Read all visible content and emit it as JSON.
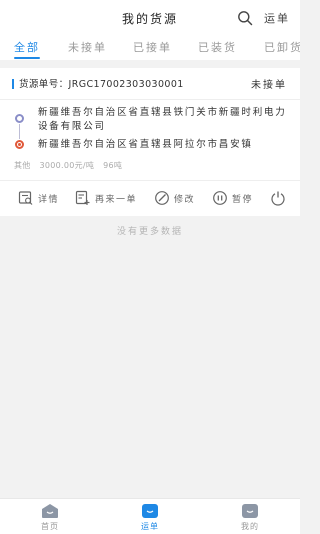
{
  "header": {
    "title": "我的货源",
    "search_icon": "search-icon",
    "ship_label": "运单"
  },
  "tabs": [
    {
      "label": "全部",
      "active": true
    },
    {
      "label": "未接单",
      "active": false
    },
    {
      "label": "已接单",
      "active": false
    },
    {
      "label": "已装货",
      "active": false
    },
    {
      "label": "已卸货",
      "active": false
    }
  ],
  "cargo": {
    "number_label": "货源单号：",
    "number": "JRGC17002303030001",
    "status": "未接单",
    "from_address": "新疆维吾尔自治区省直辖县铁门关市新疆时利电力设备有限公司",
    "to_address": "新疆维吾尔自治区省直辖县阿拉尔市昌安镇",
    "meta": [
      "其他",
      "3000.00元/吨",
      "96吨"
    ],
    "actions": [
      {
        "label": "详情",
        "icon": "detail-icon"
      },
      {
        "label": "再来一单",
        "icon": "add-order-icon"
      },
      {
        "label": "修改",
        "icon": "edit-icon"
      },
      {
        "label": "暂停",
        "icon": "pause-icon"
      },
      {
        "label": "",
        "icon": "power-icon"
      }
    ]
  },
  "no_more_text": "没有更多数据",
  "tabbar": [
    {
      "label": "首页",
      "icon": "home-icon",
      "active": false
    },
    {
      "label": "运单",
      "icon": "waybill-icon",
      "active": true
    },
    {
      "label": "我的",
      "icon": "profile-icon",
      "active": false
    }
  ],
  "colors": {
    "accent": "#1e88e5",
    "end_dot": "#e0593a",
    "start_dot": "#8a8ec8"
  }
}
